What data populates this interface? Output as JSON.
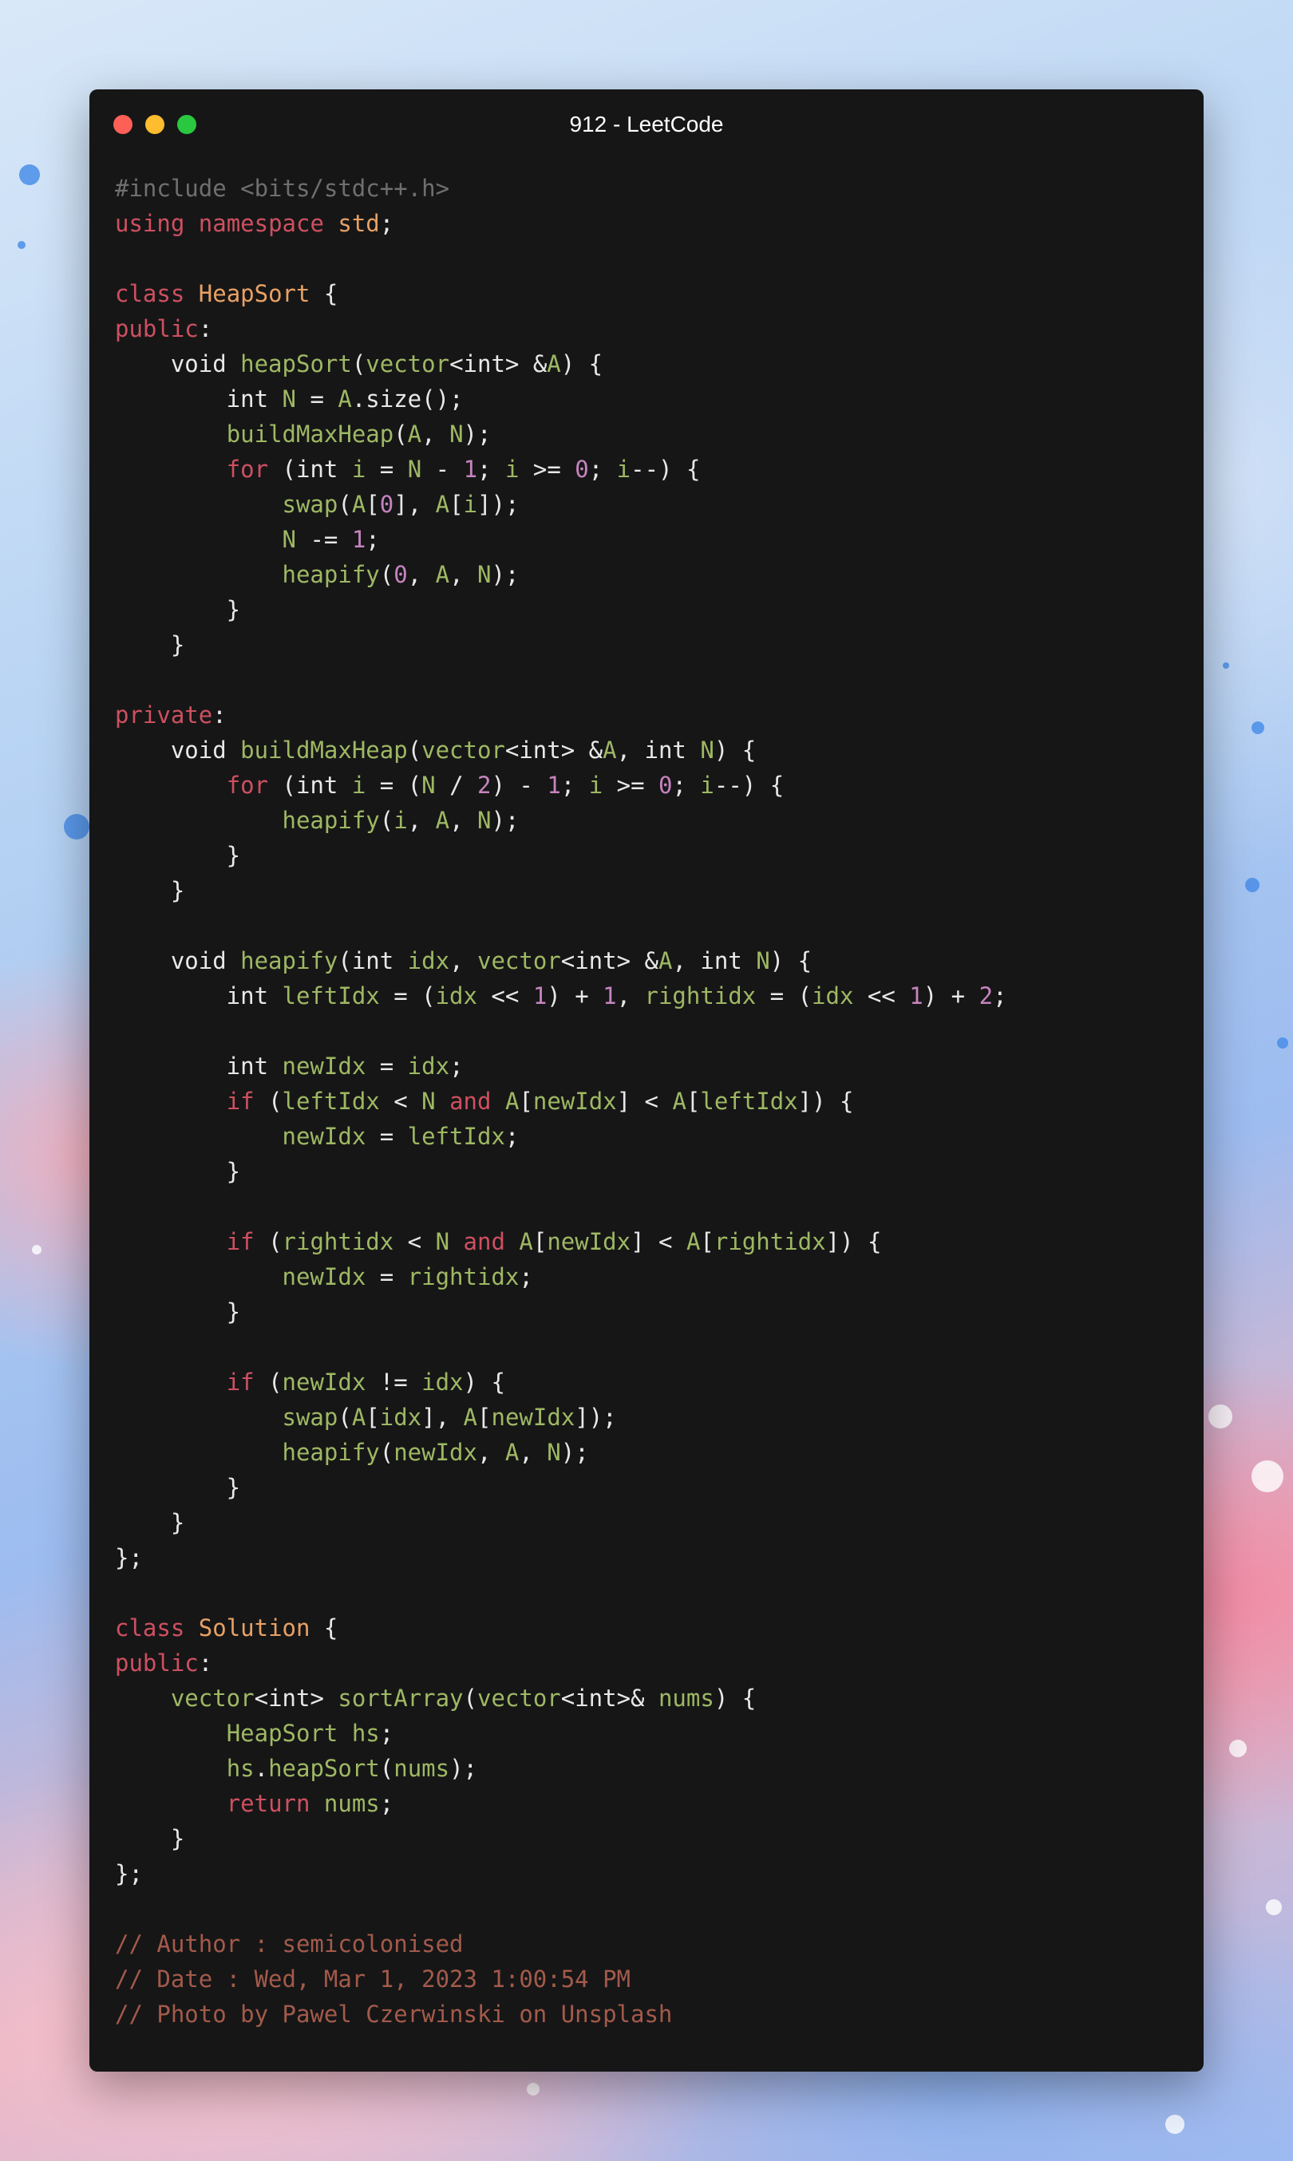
{
  "window": {
    "title": "912 - LeetCode",
    "controls": [
      "close",
      "minimize",
      "maximize"
    ]
  },
  "colors": {
    "window_bg": "#161617",
    "plain": "#e8e8e8",
    "preprocessor": "#6f6f6f",
    "keyword": "#ce5060",
    "class_name": "#e8a164",
    "identifier": "#9eb863",
    "number": "#c684be",
    "comment": "#a35a4a",
    "close": "#fe5f57",
    "minimize": "#febc2e",
    "maximize": "#29c840"
  },
  "code_lines": [
    [
      {
        "t": "prep",
        "v": "#include <bits/stdc++.h>"
      }
    ],
    [
      {
        "t": "kw",
        "v": "using"
      },
      {
        "t": "plain",
        "v": " "
      },
      {
        "t": "kw",
        "v": "namespace"
      },
      {
        "t": "plain",
        "v": " "
      },
      {
        "t": "cls",
        "v": "std"
      },
      {
        "t": "plain",
        "v": ";"
      }
    ],
    [],
    [
      {
        "t": "kw",
        "v": "class"
      },
      {
        "t": "plain",
        "v": " "
      },
      {
        "t": "cls",
        "v": "HeapSort"
      },
      {
        "t": "plain",
        "v": " {"
      }
    ],
    [
      {
        "t": "kw",
        "v": "public"
      },
      {
        "t": "plain",
        "v": ":"
      }
    ],
    [
      {
        "t": "plain",
        "v": "    void "
      },
      {
        "t": "id",
        "v": "heapSort"
      },
      {
        "t": "plain",
        "v": "("
      },
      {
        "t": "id",
        "v": "vector"
      },
      {
        "t": "plain",
        "v": "<int> &"
      },
      {
        "t": "id",
        "v": "A"
      },
      {
        "t": "plain",
        "v": ") {"
      }
    ],
    [
      {
        "t": "plain",
        "v": "        int "
      },
      {
        "t": "id",
        "v": "N"
      },
      {
        "t": "plain",
        "v": " = "
      },
      {
        "t": "id",
        "v": "A"
      },
      {
        "t": "plain",
        "v": ".size();"
      }
    ],
    [
      {
        "t": "plain",
        "v": "        "
      },
      {
        "t": "id",
        "v": "buildMaxHeap"
      },
      {
        "t": "plain",
        "v": "("
      },
      {
        "t": "id",
        "v": "A"
      },
      {
        "t": "plain",
        "v": ", "
      },
      {
        "t": "id",
        "v": "N"
      },
      {
        "t": "plain",
        "v": ");"
      }
    ],
    [
      {
        "t": "plain",
        "v": "        "
      },
      {
        "t": "kw",
        "v": "for"
      },
      {
        "t": "plain",
        "v": " (int "
      },
      {
        "t": "id",
        "v": "i"
      },
      {
        "t": "plain",
        "v": " = "
      },
      {
        "t": "id",
        "v": "N"
      },
      {
        "t": "plain",
        "v": " - "
      },
      {
        "t": "num",
        "v": "1"
      },
      {
        "t": "plain",
        "v": "; "
      },
      {
        "t": "id",
        "v": "i"
      },
      {
        "t": "plain",
        "v": " >= "
      },
      {
        "t": "num",
        "v": "0"
      },
      {
        "t": "plain",
        "v": "; "
      },
      {
        "t": "id",
        "v": "i"
      },
      {
        "t": "plain",
        "v": "--) {"
      }
    ],
    [
      {
        "t": "plain",
        "v": "            "
      },
      {
        "t": "id",
        "v": "swap"
      },
      {
        "t": "plain",
        "v": "("
      },
      {
        "t": "id",
        "v": "A"
      },
      {
        "t": "plain",
        "v": "["
      },
      {
        "t": "num",
        "v": "0"
      },
      {
        "t": "plain",
        "v": "], "
      },
      {
        "t": "id",
        "v": "A"
      },
      {
        "t": "plain",
        "v": "["
      },
      {
        "t": "id",
        "v": "i"
      },
      {
        "t": "plain",
        "v": "]);"
      }
    ],
    [
      {
        "t": "plain",
        "v": "            "
      },
      {
        "t": "id",
        "v": "N"
      },
      {
        "t": "plain",
        "v": " -= "
      },
      {
        "t": "num",
        "v": "1"
      },
      {
        "t": "plain",
        "v": ";"
      }
    ],
    [
      {
        "t": "plain",
        "v": "            "
      },
      {
        "t": "id",
        "v": "heapify"
      },
      {
        "t": "plain",
        "v": "("
      },
      {
        "t": "num",
        "v": "0"
      },
      {
        "t": "plain",
        "v": ", "
      },
      {
        "t": "id",
        "v": "A"
      },
      {
        "t": "plain",
        "v": ", "
      },
      {
        "t": "id",
        "v": "N"
      },
      {
        "t": "plain",
        "v": ");"
      }
    ],
    [
      {
        "t": "plain",
        "v": "        }"
      }
    ],
    [
      {
        "t": "plain",
        "v": "    }"
      }
    ],
    [],
    [
      {
        "t": "kw",
        "v": "private"
      },
      {
        "t": "plain",
        "v": ":"
      }
    ],
    [
      {
        "t": "plain",
        "v": "    void "
      },
      {
        "t": "id",
        "v": "buildMaxHeap"
      },
      {
        "t": "plain",
        "v": "("
      },
      {
        "t": "id",
        "v": "vector"
      },
      {
        "t": "plain",
        "v": "<int> &"
      },
      {
        "t": "id",
        "v": "A"
      },
      {
        "t": "plain",
        "v": ", int "
      },
      {
        "t": "id",
        "v": "N"
      },
      {
        "t": "plain",
        "v": ") {"
      }
    ],
    [
      {
        "t": "plain",
        "v": "        "
      },
      {
        "t": "kw",
        "v": "for"
      },
      {
        "t": "plain",
        "v": " (int "
      },
      {
        "t": "id",
        "v": "i"
      },
      {
        "t": "plain",
        "v": " = ("
      },
      {
        "t": "id",
        "v": "N"
      },
      {
        "t": "plain",
        "v": " / "
      },
      {
        "t": "num",
        "v": "2"
      },
      {
        "t": "plain",
        "v": ") - "
      },
      {
        "t": "num",
        "v": "1"
      },
      {
        "t": "plain",
        "v": "; "
      },
      {
        "t": "id",
        "v": "i"
      },
      {
        "t": "plain",
        "v": " >= "
      },
      {
        "t": "num",
        "v": "0"
      },
      {
        "t": "plain",
        "v": "; "
      },
      {
        "t": "id",
        "v": "i"
      },
      {
        "t": "plain",
        "v": "--) {"
      }
    ],
    [
      {
        "t": "plain",
        "v": "            "
      },
      {
        "t": "id",
        "v": "heapify"
      },
      {
        "t": "plain",
        "v": "("
      },
      {
        "t": "id",
        "v": "i"
      },
      {
        "t": "plain",
        "v": ", "
      },
      {
        "t": "id",
        "v": "A"
      },
      {
        "t": "plain",
        "v": ", "
      },
      {
        "t": "id",
        "v": "N"
      },
      {
        "t": "plain",
        "v": ");"
      }
    ],
    [
      {
        "t": "plain",
        "v": "        }"
      }
    ],
    [
      {
        "t": "plain",
        "v": "    }"
      }
    ],
    [],
    [
      {
        "t": "plain",
        "v": "    void "
      },
      {
        "t": "id",
        "v": "heapify"
      },
      {
        "t": "plain",
        "v": "(int "
      },
      {
        "t": "id",
        "v": "idx"
      },
      {
        "t": "plain",
        "v": ", "
      },
      {
        "t": "id",
        "v": "vector"
      },
      {
        "t": "plain",
        "v": "<int> &"
      },
      {
        "t": "id",
        "v": "A"
      },
      {
        "t": "plain",
        "v": ", int "
      },
      {
        "t": "id",
        "v": "N"
      },
      {
        "t": "plain",
        "v": ") {"
      }
    ],
    [
      {
        "t": "plain",
        "v": "        int "
      },
      {
        "t": "id",
        "v": "leftIdx"
      },
      {
        "t": "plain",
        "v": " = ("
      },
      {
        "t": "id",
        "v": "idx"
      },
      {
        "t": "plain",
        "v": " << "
      },
      {
        "t": "num",
        "v": "1"
      },
      {
        "t": "plain",
        "v": ") + "
      },
      {
        "t": "num",
        "v": "1"
      },
      {
        "t": "plain",
        "v": ", "
      },
      {
        "t": "id",
        "v": "rightidx"
      },
      {
        "t": "plain",
        "v": " = ("
      },
      {
        "t": "id",
        "v": "idx"
      },
      {
        "t": "plain",
        "v": " << "
      },
      {
        "t": "num",
        "v": "1"
      },
      {
        "t": "plain",
        "v": ") + "
      },
      {
        "t": "num",
        "v": "2"
      },
      {
        "t": "plain",
        "v": ";"
      }
    ],
    [],
    [
      {
        "t": "plain",
        "v": "        int "
      },
      {
        "t": "id",
        "v": "newIdx"
      },
      {
        "t": "plain",
        "v": " = "
      },
      {
        "t": "id",
        "v": "idx"
      },
      {
        "t": "plain",
        "v": ";"
      }
    ],
    [
      {
        "t": "plain",
        "v": "        "
      },
      {
        "t": "kw",
        "v": "if"
      },
      {
        "t": "plain",
        "v": " ("
      },
      {
        "t": "id",
        "v": "leftIdx"
      },
      {
        "t": "plain",
        "v": " < "
      },
      {
        "t": "id",
        "v": "N"
      },
      {
        "t": "plain",
        "v": " "
      },
      {
        "t": "kw",
        "v": "and"
      },
      {
        "t": "plain",
        "v": " "
      },
      {
        "t": "id",
        "v": "A"
      },
      {
        "t": "plain",
        "v": "["
      },
      {
        "t": "id",
        "v": "newIdx"
      },
      {
        "t": "plain",
        "v": "] < "
      },
      {
        "t": "id",
        "v": "A"
      },
      {
        "t": "plain",
        "v": "["
      },
      {
        "t": "id",
        "v": "leftIdx"
      },
      {
        "t": "plain",
        "v": "]) {"
      }
    ],
    [
      {
        "t": "plain",
        "v": "            "
      },
      {
        "t": "id",
        "v": "newIdx"
      },
      {
        "t": "plain",
        "v": " = "
      },
      {
        "t": "id",
        "v": "leftIdx"
      },
      {
        "t": "plain",
        "v": ";"
      }
    ],
    [
      {
        "t": "plain",
        "v": "        }"
      }
    ],
    [],
    [
      {
        "t": "plain",
        "v": "        "
      },
      {
        "t": "kw",
        "v": "if"
      },
      {
        "t": "plain",
        "v": " ("
      },
      {
        "t": "id",
        "v": "rightidx"
      },
      {
        "t": "plain",
        "v": " < "
      },
      {
        "t": "id",
        "v": "N"
      },
      {
        "t": "plain",
        "v": " "
      },
      {
        "t": "kw",
        "v": "and"
      },
      {
        "t": "plain",
        "v": " "
      },
      {
        "t": "id",
        "v": "A"
      },
      {
        "t": "plain",
        "v": "["
      },
      {
        "t": "id",
        "v": "newIdx"
      },
      {
        "t": "plain",
        "v": "] < "
      },
      {
        "t": "id",
        "v": "A"
      },
      {
        "t": "plain",
        "v": "["
      },
      {
        "t": "id",
        "v": "rightidx"
      },
      {
        "t": "plain",
        "v": "]) {"
      }
    ],
    [
      {
        "t": "plain",
        "v": "            "
      },
      {
        "t": "id",
        "v": "newIdx"
      },
      {
        "t": "plain",
        "v": " = "
      },
      {
        "t": "id",
        "v": "rightidx"
      },
      {
        "t": "plain",
        "v": ";"
      }
    ],
    [
      {
        "t": "plain",
        "v": "        }"
      }
    ],
    [],
    [
      {
        "t": "plain",
        "v": "        "
      },
      {
        "t": "kw",
        "v": "if"
      },
      {
        "t": "plain",
        "v": " ("
      },
      {
        "t": "id",
        "v": "newIdx"
      },
      {
        "t": "plain",
        "v": " != "
      },
      {
        "t": "id",
        "v": "idx"
      },
      {
        "t": "plain",
        "v": ") {"
      }
    ],
    [
      {
        "t": "plain",
        "v": "            "
      },
      {
        "t": "id",
        "v": "swap"
      },
      {
        "t": "plain",
        "v": "("
      },
      {
        "t": "id",
        "v": "A"
      },
      {
        "t": "plain",
        "v": "["
      },
      {
        "t": "id",
        "v": "idx"
      },
      {
        "t": "plain",
        "v": "], "
      },
      {
        "t": "id",
        "v": "A"
      },
      {
        "t": "plain",
        "v": "["
      },
      {
        "t": "id",
        "v": "newIdx"
      },
      {
        "t": "plain",
        "v": "]);"
      }
    ],
    [
      {
        "t": "plain",
        "v": "            "
      },
      {
        "t": "id",
        "v": "heapify"
      },
      {
        "t": "plain",
        "v": "("
      },
      {
        "t": "id",
        "v": "newIdx"
      },
      {
        "t": "plain",
        "v": ", "
      },
      {
        "t": "id",
        "v": "A"
      },
      {
        "t": "plain",
        "v": ", "
      },
      {
        "t": "id",
        "v": "N"
      },
      {
        "t": "plain",
        "v": ");"
      }
    ],
    [
      {
        "t": "plain",
        "v": "        }"
      }
    ],
    [
      {
        "t": "plain",
        "v": "    }"
      }
    ],
    [
      {
        "t": "plain",
        "v": "};"
      }
    ],
    [],
    [
      {
        "t": "kw",
        "v": "class"
      },
      {
        "t": "plain",
        "v": " "
      },
      {
        "t": "cls",
        "v": "Solution"
      },
      {
        "t": "plain",
        "v": " {"
      }
    ],
    [
      {
        "t": "kw",
        "v": "public"
      },
      {
        "t": "plain",
        "v": ":"
      }
    ],
    [
      {
        "t": "plain",
        "v": "    "
      },
      {
        "t": "id",
        "v": "vector"
      },
      {
        "t": "plain",
        "v": "<int> "
      },
      {
        "t": "id",
        "v": "sortArray"
      },
      {
        "t": "plain",
        "v": "("
      },
      {
        "t": "id",
        "v": "vector"
      },
      {
        "t": "plain",
        "v": "<int>& "
      },
      {
        "t": "id",
        "v": "nums"
      },
      {
        "t": "plain",
        "v": ") {"
      }
    ],
    [
      {
        "t": "plain",
        "v": "        "
      },
      {
        "t": "id",
        "v": "HeapSort"
      },
      {
        "t": "plain",
        "v": " "
      },
      {
        "t": "id",
        "v": "hs"
      },
      {
        "t": "plain",
        "v": ";"
      }
    ],
    [
      {
        "t": "plain",
        "v": "        "
      },
      {
        "t": "id",
        "v": "hs"
      },
      {
        "t": "plain",
        "v": "."
      },
      {
        "t": "id",
        "v": "heapSort"
      },
      {
        "t": "plain",
        "v": "("
      },
      {
        "t": "id",
        "v": "nums"
      },
      {
        "t": "plain",
        "v": ");"
      }
    ],
    [
      {
        "t": "plain",
        "v": "        "
      },
      {
        "t": "kw",
        "v": "return"
      },
      {
        "t": "plain",
        "v": " "
      },
      {
        "t": "id",
        "v": "nums"
      },
      {
        "t": "plain",
        "v": ";"
      }
    ],
    [
      {
        "t": "plain",
        "v": "    }"
      }
    ],
    [
      {
        "t": "plain",
        "v": "};"
      }
    ],
    [],
    [
      {
        "t": "cmt",
        "v": "// Author : semicolonised"
      }
    ],
    [
      {
        "t": "cmt",
        "v": "// Date : Wed, Mar 1, 2023 1:00:54 PM"
      }
    ],
    [
      {
        "t": "cmt",
        "v": "// Photo by Pawel Czerwinski on Unsplash"
      }
    ]
  ]
}
